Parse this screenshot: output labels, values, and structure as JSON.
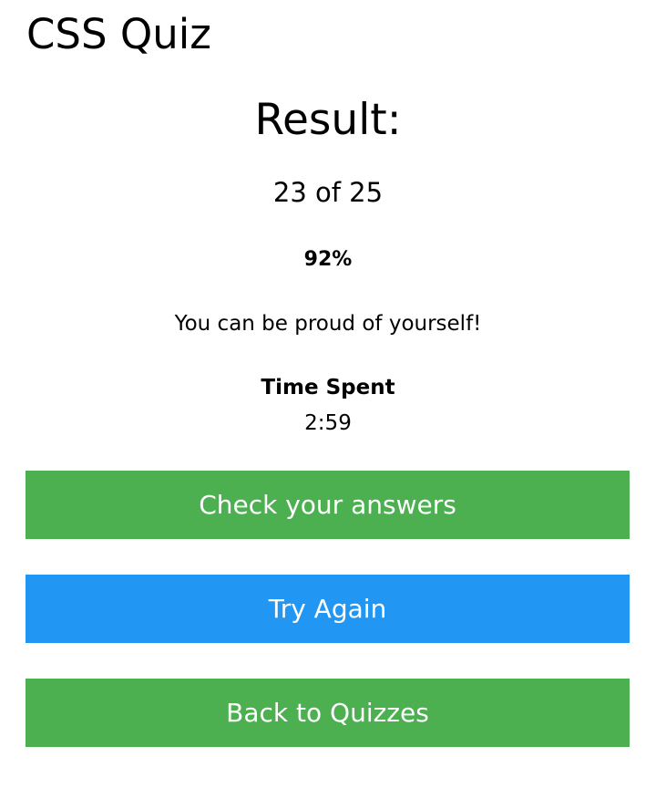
{
  "header": {
    "title": "CSS Quiz"
  },
  "result": {
    "heading": "Result:",
    "score": "23 of 25",
    "percent": "92%",
    "message": "You can be proud of yourself!",
    "time_label": "Time Spent",
    "time_value": "2:59"
  },
  "actions": {
    "check_label": "Check your answers",
    "retry_label": "Try Again",
    "back_label": "Back to Quizzes"
  },
  "colors": {
    "green": "#4caf50",
    "blue": "#2196f3",
    "button_text": "#ffffff"
  }
}
